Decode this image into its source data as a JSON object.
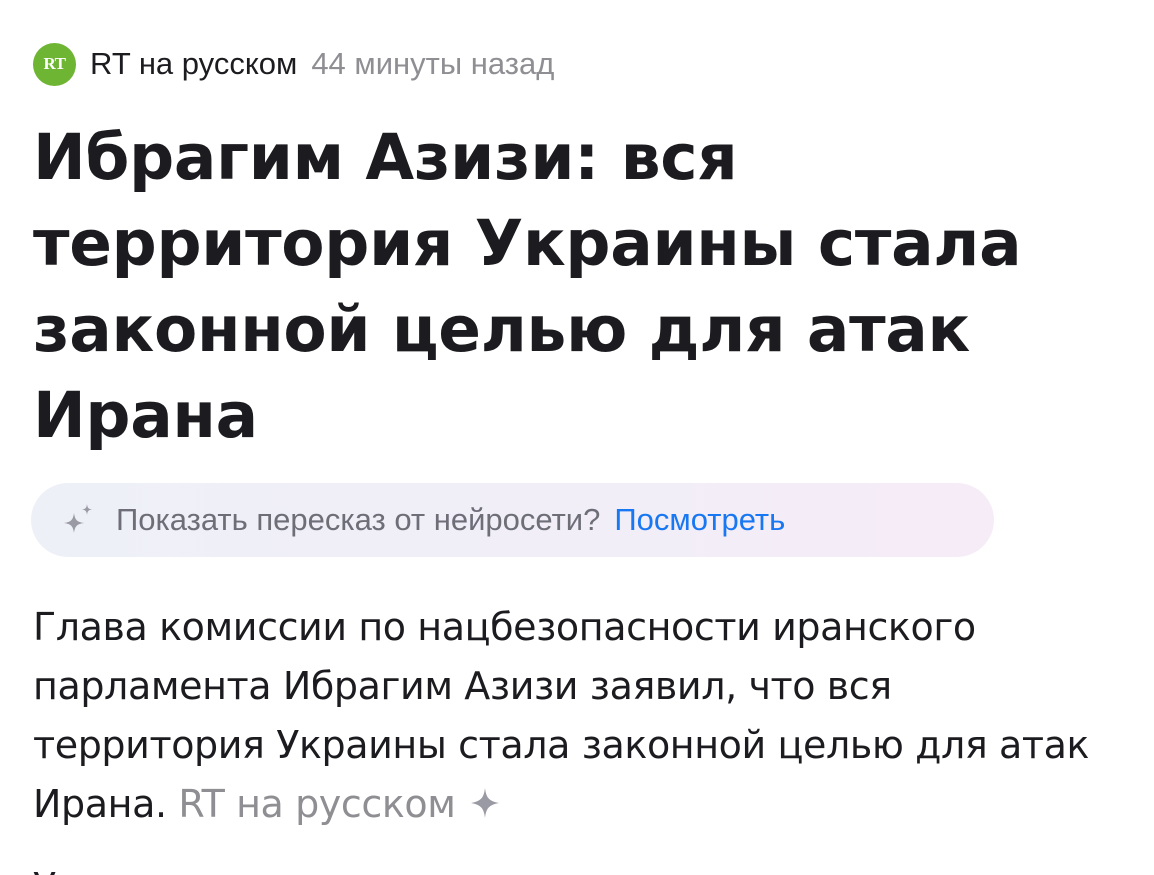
{
  "source": {
    "logo_text": "RT",
    "name": "RT на русском",
    "time": "44 минуты назад",
    "logo_color": "#6fb534"
  },
  "article": {
    "title": "Ибрагим Азизи: вся территория Украины стала законной целью для атак Ирана",
    "body": "Глава комиссии по нацбезопасности иранского парламента Ибрагим Азизи заявил, что вся территория Украины стала законной целью для атак Ирана.",
    "body_source": "RT на русском",
    "next_line_start": "У"
  },
  "ai_summary": {
    "prompt": "Показать пересказ от нейросети?",
    "link": "Посмотреть",
    "icon": "sparkle-icon",
    "link_color": "#1877f2"
  }
}
